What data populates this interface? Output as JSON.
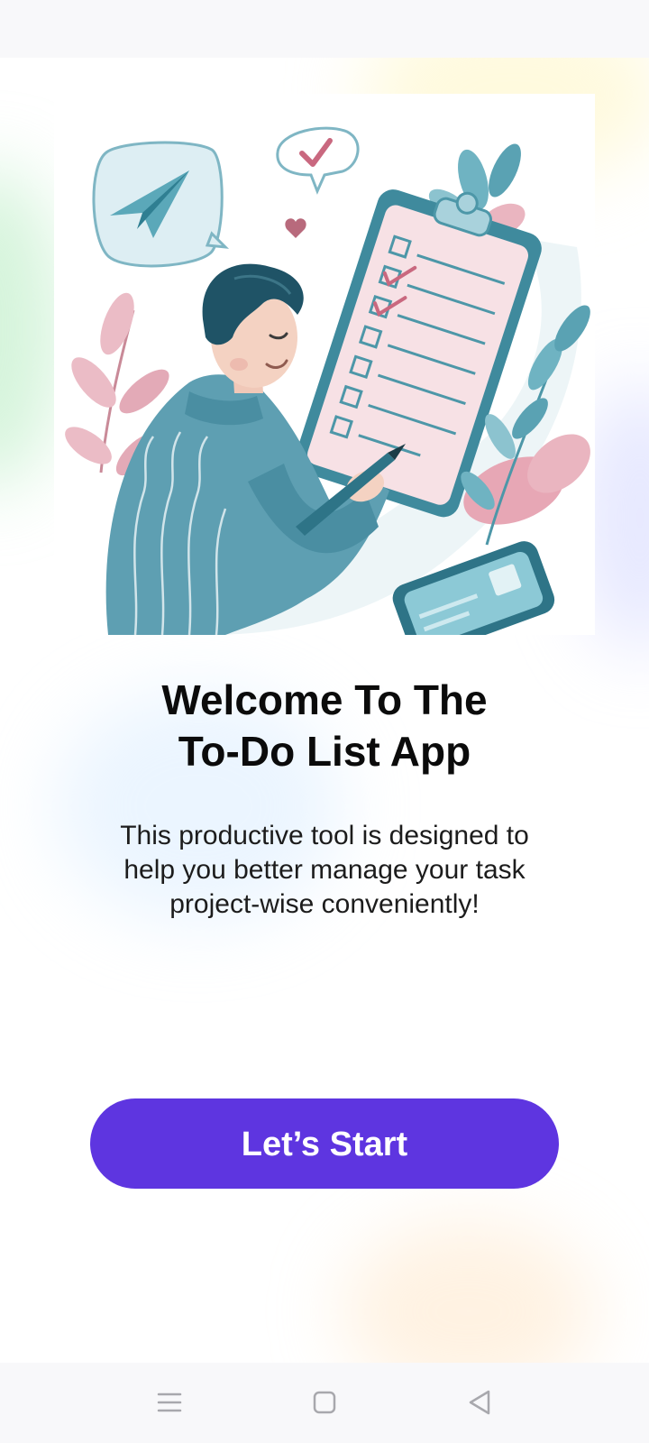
{
  "welcome": {
    "title_line1": "Welcome To The",
    "title_line2": "To-Do List App",
    "description_line1": "This productive tool is designed to",
    "description_line2": "help you better manage your task",
    "description_line3": "project-wise conveniently!"
  },
  "start_button": {
    "label": "Let’s Start"
  },
  "illustration": {
    "icons": [
      "paper-plane-icon",
      "checkmark-bubble-icon",
      "heart-icon",
      "clipboard-checklist-icon",
      "pen-icon",
      "smartphone-icon",
      "leaf-icon"
    ]
  },
  "navigation_bar": {
    "icons": [
      "menu-icon",
      "home-square-icon",
      "back-triangle-icon"
    ]
  },
  "colors": {
    "accent": "#5e35e0",
    "title_text": "#0b0b0b",
    "body_text": "#1c1c1c",
    "illustration_teal": "#4f9aab",
    "illustration_pink": "#d99aa8",
    "system_bar": "#f8f8fa"
  }
}
